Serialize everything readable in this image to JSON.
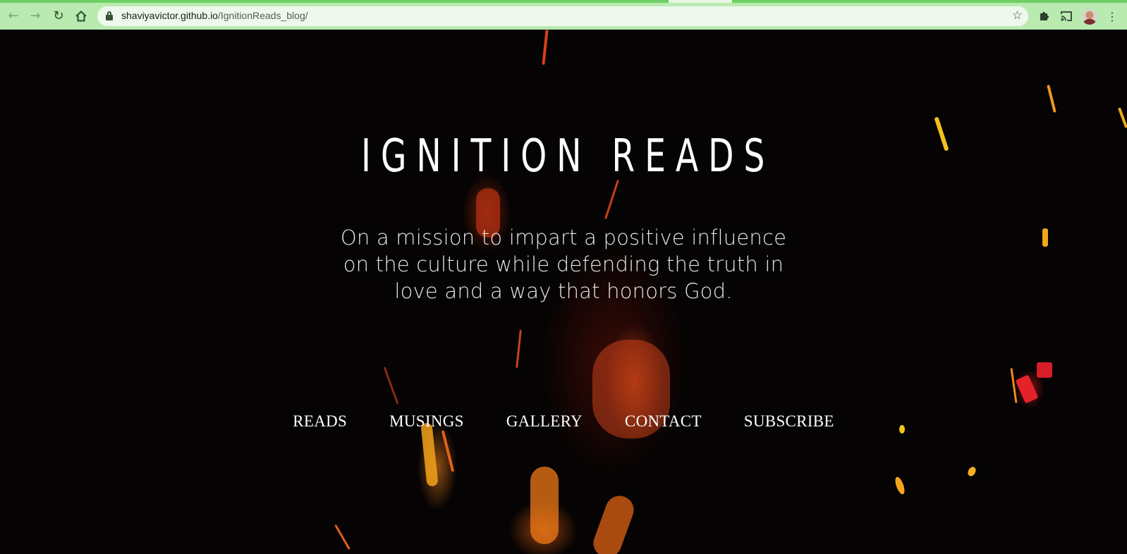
{
  "browser": {
    "url_host": "shaviyavictor.github.io",
    "url_path": "/IgnitionReads_blog/",
    "icons": {
      "back": "arrow-left-icon",
      "forward": "arrow-right-icon",
      "reload": "reload-icon",
      "home": "home-icon",
      "lock": "lock-icon",
      "bookmark": "star-icon",
      "extensions": "puzzle-icon",
      "cast": "cast-icon",
      "menu": "kebab-menu-icon"
    },
    "theme_color": "#b9eab0"
  },
  "page": {
    "title": "IGNITION READS",
    "tagline": "On a mission to impart a positive influence on the culture while defending the truth in love and a way that honors God.",
    "nav": {
      "reads": "READS",
      "musings": "MUSINGS",
      "gallery": "GALLERY",
      "contact": "CONTACT",
      "subscribe": "SUBSCRIBE"
    },
    "background": "fire-embers-image",
    "text_color": "#ffffff"
  }
}
